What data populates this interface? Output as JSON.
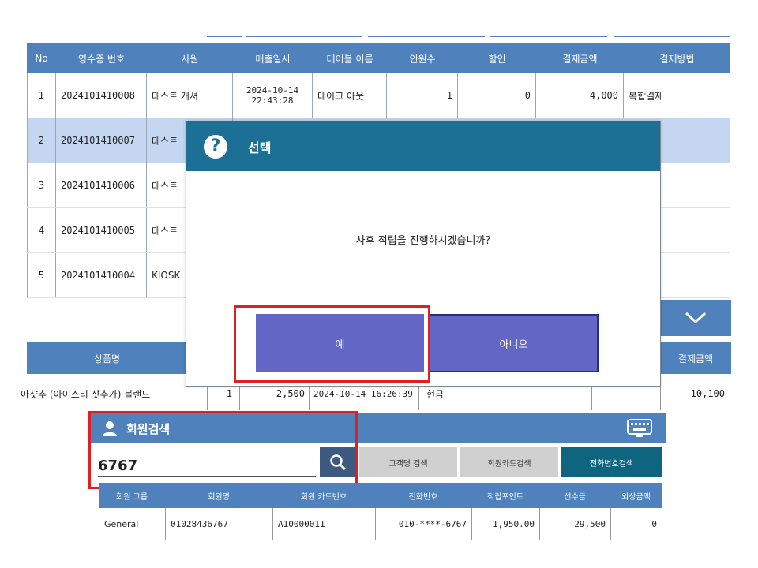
{
  "sales_table": {
    "headers": [
      "No",
      "영수증 번호",
      "사원",
      "매출일시",
      "테이블 이름",
      "인원수",
      "할인",
      "결제금액",
      "결제방법"
    ],
    "rows": [
      {
        "no": "1",
        "receipt": "2024101410008",
        "staff": "테스트 캐셔",
        "date": "2024-10-14",
        "time": "22:43:28",
        "table": "테이크 아웃",
        "people": "1",
        "discount": "0",
        "amount": "4,000",
        "method": "복합결제"
      },
      {
        "no": "2",
        "receipt": "2024101410007",
        "staff": "테스트"
      },
      {
        "no": "3",
        "receipt": "2024101410006",
        "staff": "테스트"
      },
      {
        "no": "4",
        "receipt": "2024101410005",
        "staff": "테스트"
      },
      {
        "no": "5",
        "receipt": "2024101410004",
        "staff": "KIOSK"
      }
    ]
  },
  "dialog": {
    "title": "선택",
    "icon": "question-icon",
    "message": "사후 적립을 진행하시겠습니까?",
    "yes_label": "예",
    "no_label": "아니오"
  },
  "product_table": {
    "header_name": "상품명",
    "header_amount": "결제금액",
    "row": {
      "name": "아샷추 (아이스티 샷추가) 블랜드",
      "qty": "1",
      "price": "2,500",
      "datetime": "2024-10-14 16:26:39",
      "method": "현금",
      "amount": "10,100"
    }
  },
  "member_search": {
    "title": "회원검색",
    "input_value": "6767",
    "tabs": [
      "고객명 검색",
      "회원카드검색",
      "전화번호검색"
    ],
    "active_tab": "전화번호검색",
    "headers": [
      "회원 그룹",
      "회원명",
      "회원 카드번호",
      "전화번호",
      "적립포인트",
      "선수금",
      "외상금액"
    ],
    "rows": [
      {
        "group": "General",
        "name": "01028436767",
        "card": "A10000011",
        "phone": "010-****-6767",
        "points": "1,950.00",
        "prepaid": "29,500",
        "credit": "0"
      }
    ]
  },
  "colors": {
    "header_blue": "#4f81bd",
    "dialog_teal": "#1c7096",
    "button_purple": "#6366c4",
    "highlight_red": "#e02020",
    "selected_row": "#c5d7f0"
  }
}
